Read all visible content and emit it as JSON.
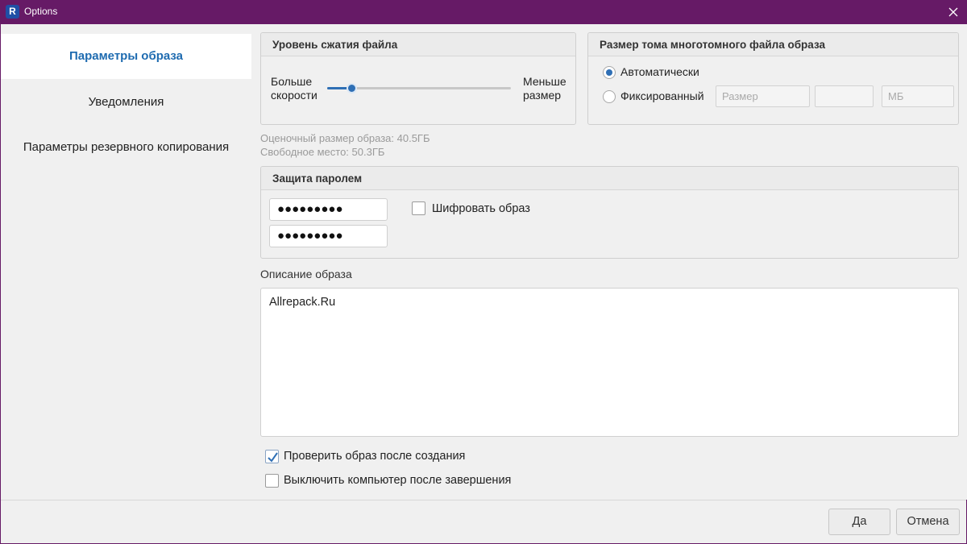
{
  "window": {
    "title": "Options",
    "app_icon_letter": "R"
  },
  "sidebar": {
    "items": [
      {
        "label": "Параметры образа",
        "active": true
      },
      {
        "label": "Уведомления",
        "active": false
      },
      {
        "label": "Параметры резервного копирования",
        "active": false
      }
    ]
  },
  "compression": {
    "title": "Уровень сжатия файла",
    "left_label_1": "Больше",
    "left_label_2": "скорости",
    "right_label_1": "Меньше",
    "right_label_2": "размер",
    "slider_level": 0.13
  },
  "volume_size": {
    "title": "Размер тома многотомного файла образа",
    "auto_label": "Автоматически",
    "fixed_label": "Фиксированный",
    "selected": "auto",
    "size_placeholder": "Размер",
    "value_placeholder": "",
    "unit_placeholder": "МБ"
  },
  "info": {
    "estimated": "Оценочный размер образа: 40.5ГБ",
    "free": "Свободное место: 50.3ГБ"
  },
  "password": {
    "title": "Защита паролем",
    "password_value": "●●●●●●●●●",
    "confirm_value": "●●●●●●●●●",
    "encrypt_label": "Шифровать образ",
    "encrypt_checked": false
  },
  "description": {
    "label": "Описание образа",
    "value": "Allrepack.Ru"
  },
  "options": {
    "verify_label": "Проверить  образ после создания",
    "verify_checked": true,
    "shutdown_label": "Выключить компьютер после завершения",
    "shutdown_checked": false
  },
  "buttons": {
    "ok": "Да",
    "cancel": "Отмена"
  },
  "colors": {
    "titlebar": "#661a66",
    "accent": "#1e6bb0",
    "slider": "#2f6fb5"
  }
}
